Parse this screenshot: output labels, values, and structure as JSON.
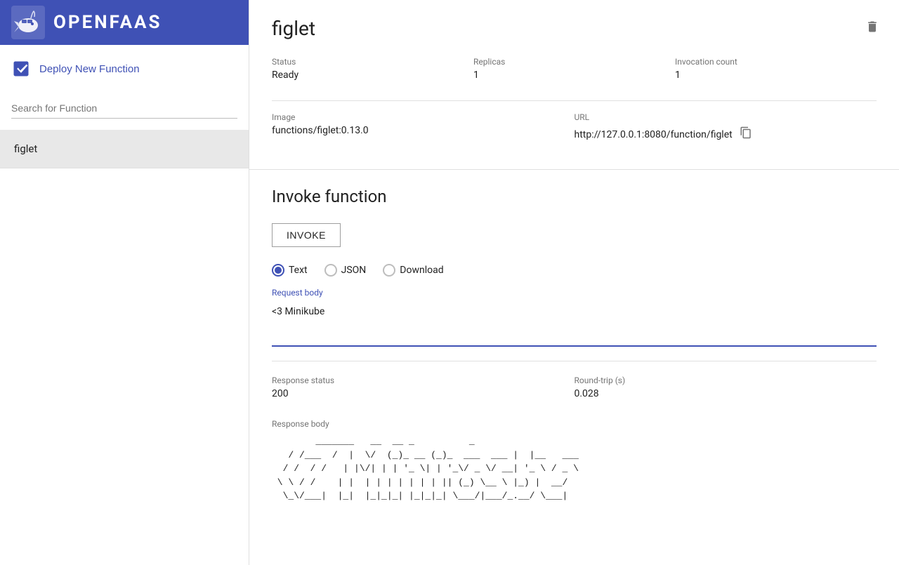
{
  "brand": {
    "name": "OPENFAAS"
  },
  "sidebar": {
    "deploy_label": "Deploy New Function",
    "search_placeholder": "Search for Function",
    "functions": [
      {
        "name": "figlet"
      }
    ]
  },
  "detail": {
    "title": "figlet",
    "delete_icon": "🗑",
    "status_label": "Status",
    "status_value": "Ready",
    "replicas_label": "Replicas",
    "replicas_value": "1",
    "invocation_label": "Invocation count",
    "invocation_value": "1",
    "image_label": "Image",
    "image_value": "functions/figlet:0.13.0",
    "url_label": "URL",
    "url_value": "http://127.0.0.1:8080/function/figlet"
  },
  "invoke": {
    "title": "Invoke function",
    "invoke_button": "INVOKE",
    "response_types": [
      {
        "id": "text",
        "label": "Text",
        "selected": true
      },
      {
        "id": "json",
        "label": "JSON",
        "selected": false
      },
      {
        "id": "download",
        "label": "Download",
        "selected": false
      }
    ],
    "request_body_label": "Request body",
    "request_body_value": "<3 Minikube",
    "response_status_label": "Response status",
    "response_status_value": "200",
    "round_trip_label": "Round-trip (s)",
    "round_trip_value": "0.028",
    "response_body_label": "Response body",
    "response_body_value": "        _______   __  __  _         _      \n   / /___  /  |  \\/  (_)_ __ (_)_  _____  ___|  |__   ___ \n  / /  / /  | |\\/| | | '_ \\| | '_/ _ \\/ __|  _ \\ / _ \\\n \\ \\ / /   | |  | | | | | | | || (_) \\__ \\ |_) |  __/\n  \\_\\/___|  |_|  |_|_|_| |_|_|_| \\___/|___/_.__/ \\___|\n"
  }
}
